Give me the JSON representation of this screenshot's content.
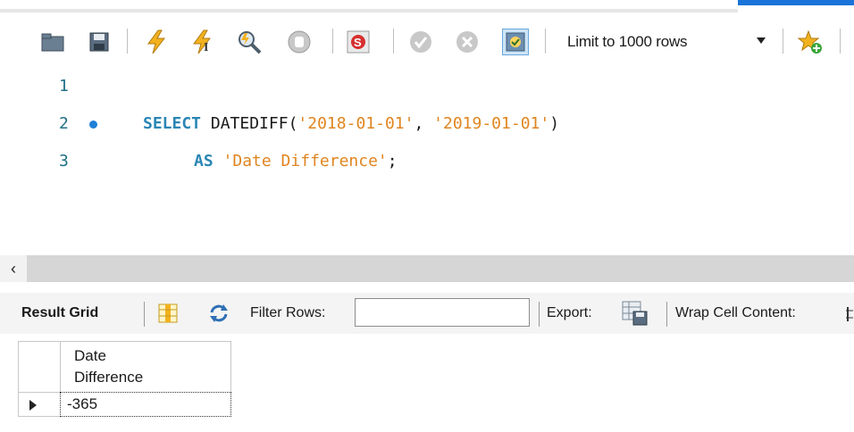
{
  "toolbar": {
    "limit_label": "Limit to 1000 rows",
    "icons": [
      "open-folder-icon",
      "save-icon",
      "execute-icon",
      "execute-current-icon",
      "explain-icon",
      "stop-icon",
      "toggle-error-icon",
      "commit-icon",
      "rollback-icon",
      "autocommit-icon",
      "add-snippet-icon"
    ]
  },
  "editor": {
    "lines": [
      {
        "number": "1"
      },
      {
        "number": "2",
        "select_kw": "SELECT",
        "fn": "DATEDIFF",
        "open": "(",
        "str1": "'2018-01-01'",
        "comma": ", ",
        "str2": "'2019-01-01'",
        "close": ")"
      },
      {
        "number": "3",
        "as_kw": "AS",
        "alias": "'Date Difference'",
        "semi": ";"
      }
    ]
  },
  "scrollbar": {
    "left_arrow": "‹"
  },
  "results": {
    "result_grid_label": "Result Grid",
    "filter_label": "Filter Rows:",
    "filter_value": "",
    "export_label": "Export:",
    "wrap_label": "Wrap Cell Content:",
    "columns": [
      {
        "line1": "Date",
        "line2": "Difference"
      }
    ],
    "rows": [
      [
        "-365"
      ]
    ]
  },
  "colors": {
    "keyword": "#2a86b5",
    "string": "#e0851f",
    "line_number": "#1f6f86",
    "accent": "#1a73d9"
  }
}
